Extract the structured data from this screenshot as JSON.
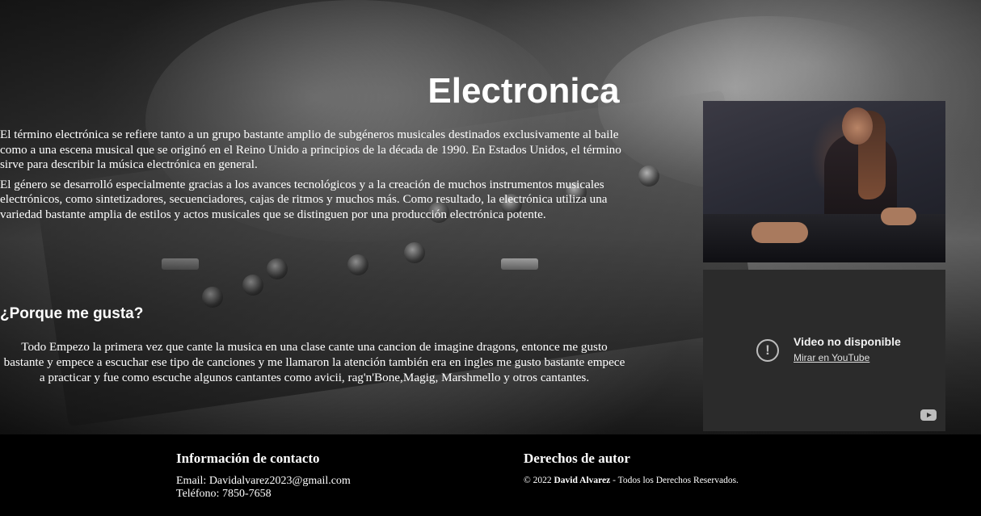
{
  "page": {
    "title": "Electronica",
    "intro_paragraphs": [
      "El término electrónica se refiere tanto a un grupo bastante amplio de subgéneros musicales destinados exclusivamente al baile como a una escena musical que se originó en el Reino Unido a principios de la década de 1990. En Estados Unidos, el término sirve para describir la música electrónica en general.",
      "El género se desarrolló especialmente gracias a los avances tecnológicos y a la creación de muchos instrumentos musicales electrónicos, como sintetizadores, secuenciadores, cajas de ritmos y muchos más. Como resultado, la electrónica utiliza una variedad bastante amplia de estilos y actos musicales que se distinguen por una producción electrónica potente."
    ],
    "section_heading": "¿Porque me gusta?",
    "section_body": "Todo Empezo la primera vez que cante la musica en una clase cante una cancion de imagine dragons, entonce me gusto bastante y empece a escuchar ese tipo de canciones y me llamaron la atención también era en ingles me gusto bastante empece a practicar y fue como escuche algunos cantantes como avicii, rag'n'Bone,Magig, Marshmello y otros cantantes."
  },
  "video": {
    "message": "Video no disponible",
    "link": "Mirar en YouTube",
    "icons": [
      "alert-icon",
      "youtube-icon"
    ]
  },
  "footer": {
    "contact_heading": "Información de contacto",
    "email": "Email: Davidalvarez2023@gmail.com",
    "phone": "Teléfono: 7850-7658",
    "rights_heading": "Derechos de autor",
    "rights_prefix": "© 2022 ",
    "rights_name": "David Alvarez",
    "rights_suffix": " - Todos los Derechos Reservados."
  },
  "colors": {
    "footer_bg": "#000000",
    "video_bg": "#2b2b2b",
    "text": "#ffffff"
  }
}
